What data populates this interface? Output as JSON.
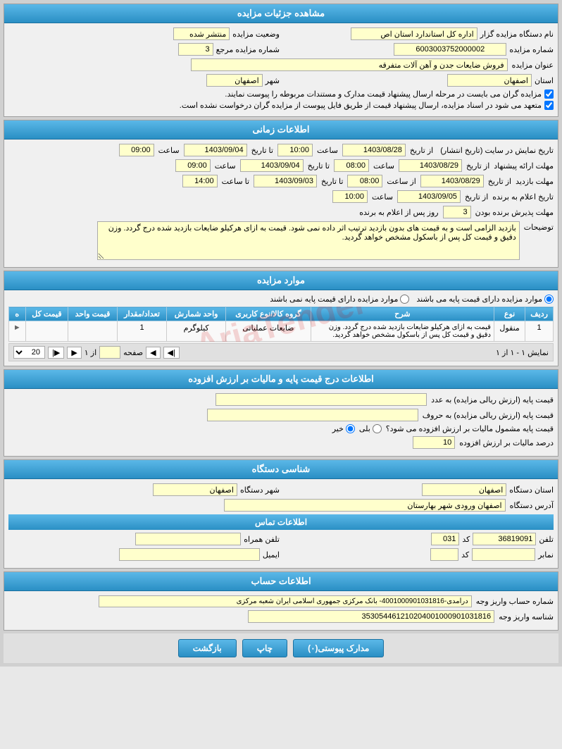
{
  "page": {
    "title": "مشاهده جزئیات مزایده"
  },
  "sections": {
    "details": {
      "header": "مشاهده جزئیات مزایده",
      "fields": {
        "auction_status_label": "وضعیت مزایده",
        "auction_status_value": "منتشر شده",
        "org_name_label": "نام دستگاه مزایده گزار",
        "org_name_value": "اداره کل استاندارد استان اص",
        "ref_number_label": "شماره مزایده مرجع",
        "ref_number_value": "3",
        "auction_number_label": "شماره مزایده",
        "auction_number_value": "6003003752000002",
        "auction_title_label": "عنوان مزایده",
        "auction_title_value": "فروش ضایعات جدن و آهن آلات متفرقه",
        "province_label": "استان",
        "province_value": "اصفهان",
        "city_label": "شهر",
        "city_value": "اصفهان",
        "checkbox1_text": "مزایده گران می بایست در مرحله ارسال پیشنهاد قیمت مدارک و مستندات مربوطه را پیوست نمایند.",
        "checkbox2_text": "متعهد می شود در اسناد مزایده، ارسال پیشنهاد قیمت از طریق فایل پیوست از مزایده گران درخواست نشده است."
      }
    },
    "timing": {
      "header": "اطلاعات زمانی",
      "display_date_label": "تاریخ نمایش در سایت (تاریخ انتشار)",
      "display_from_label": "از تاریخ",
      "display_from_date": "1403/08/28",
      "display_from_time_label": "ساعت",
      "display_from_time": "10:00",
      "display_to_label": "تا تاریخ",
      "display_to_date": "1403/09/04",
      "display_to_time_label": "ساعت",
      "display_to_time": "09:00",
      "offer_date_label": "مهلت ارائه پیشنهاد",
      "offer_from_date": "1403/08/29",
      "offer_from_time": "08:00",
      "offer_to_date": "1403/09/04",
      "offer_to_time": "09:00",
      "visit_date_label": "مهلت بازدید",
      "visit_from_date": "1403/08/29",
      "visit_from_time": "08:00",
      "visit_to_date": "1403/09/03",
      "visit_to_time": "08:00",
      "visit_to_time2": "14:00",
      "winner_date_label": "تاریخ اعلام به برنده",
      "winner_from_date": "1403/09/05",
      "winner_from_time": "10:00",
      "acceptance_label": "مهلت پذیرش برنده بودن",
      "acceptance_value": "3",
      "acceptance_unit": "روز پس از اعلام به برنده",
      "notes_label": "توضیحات",
      "notes_value": "بازدید الزامی است و به قیمت های بدون بازدید ترتیب اثر داده نمی شود. قیمت به ازای هرکیلو ضایعات بازدید شده درج گردد. وزن دقیق و قیمت کل پس از باسکول مشخص خواهد گردید."
    },
    "items": {
      "header": "موارد مزایده",
      "radio_yes": "موارد مزایده دارای قیمت پایه می باشند",
      "radio_no": "موارد مزایده دارای قیمت پایه نمی باشند",
      "table": {
        "columns": [
          "ردیف",
          "نوع",
          "شرح",
          "گروه کالا/نوع کاربری",
          "واحد شمارش",
          "تعداد/مقدار",
          "قیمت واحد",
          "قیمت کل",
          "ه"
        ],
        "rows": [
          {
            "row": "1",
            "type": "منقول",
            "desc": "قیمت به ازای هرکیلو ضایعات بازدید شده درج گردد. وزن دقیق و قیمت کل پس از باسکول مشخص خواهد گردید.",
            "group": "ضایعات عملیاتی",
            "unit": "کیلوگرم",
            "quantity": "1",
            "unit_price": "",
            "total_price": "",
            "col_h": ""
          }
        ]
      },
      "pagination": {
        "showing": "نمایش ۱ - ۱ از ۱",
        "page_label": "صفحه",
        "of_label": "از ۱",
        "per_page": "20"
      }
    },
    "base_price": {
      "header": "اطلاعات درج قیمت پایه و مالیات بر ارزش افزوده",
      "base_price_label": "قیمت پایه (ارزش ریالی مزایده) به عدد",
      "base_price_words_label": "قیمت پایه (ارزش ریالی مزایده) به حروف",
      "tax_question": "قیمت پایه مشمول مالیات بر ارزش افزوده می شود؟",
      "tax_yes": "بلی",
      "tax_no": "خیر",
      "tax_percent_label": "درصد مالیات بر ارزش افزوده",
      "tax_percent_value": "10"
    },
    "org_info": {
      "header": "شناسی دستگاه",
      "province_label": "استان دستگاه",
      "province_value": "اصفهان",
      "city_label": "شهر دستگاه",
      "city_value": "اصفهان",
      "address_label": "آدرس دستگاه",
      "address_value": "اصفهان ورودی شهر بهارستان",
      "contact_header": "اطلاعات تماس",
      "phone_label": "تلفن",
      "phone_value": "36819091",
      "code_label": "کد",
      "code_value": "031",
      "mobile_label": "تلفن همراه",
      "mobile_value": "",
      "fax_label": "نمابر",
      "fax_code_label": "کد",
      "fax_code_value": "",
      "email_label": "ایمیل",
      "email_value": ""
    },
    "bank": {
      "header": "اطلاعات حساب",
      "account_label": "شماره حساب واریز وجه",
      "account_value": "درآمدی-4001000901031816- بانک مرکزی جمهوری اسلامی ایران شعبه مرکزی",
      "shaba_label": "شناسه واریز وجه",
      "shaba_value": "353054461210204001000901031816"
    }
  },
  "buttons": {
    "documents": "مدارک پیوستی(۰)",
    "print": "چاپ",
    "back": "بازگشت"
  }
}
